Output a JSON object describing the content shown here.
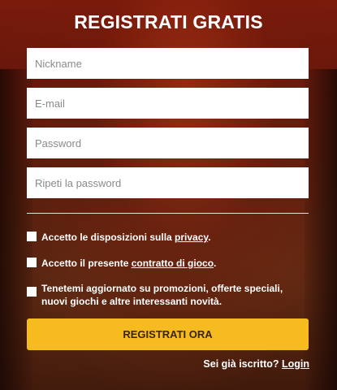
{
  "form": {
    "title": "REGISTRATI GRATIS",
    "fields": [
      {
        "placeholder": "Nickname"
      },
      {
        "placeholder": "E-mail"
      },
      {
        "placeholder": "Password"
      },
      {
        "placeholder": "Ripeti la password"
      }
    ],
    "checkboxes": {
      "privacy": {
        "text": "Accetto le disposizioni sulla ",
        "link": "privacy",
        "suffix": "."
      },
      "contract": {
        "text": "Accetto il presente ",
        "link": "contratto di gioco",
        "suffix": "."
      },
      "newsletter": {
        "text": "Tenetemi aggiornato su promozioni, offerte speciali, nuovi giochi e altre interessanti novità."
      }
    },
    "submit_label": "REGISTRATI ORA",
    "login_prompt": "Sei già iscritto? ",
    "login_link": "Login"
  },
  "colors": {
    "accent_button": "#f5bb1f",
    "background": "#4b1409"
  }
}
